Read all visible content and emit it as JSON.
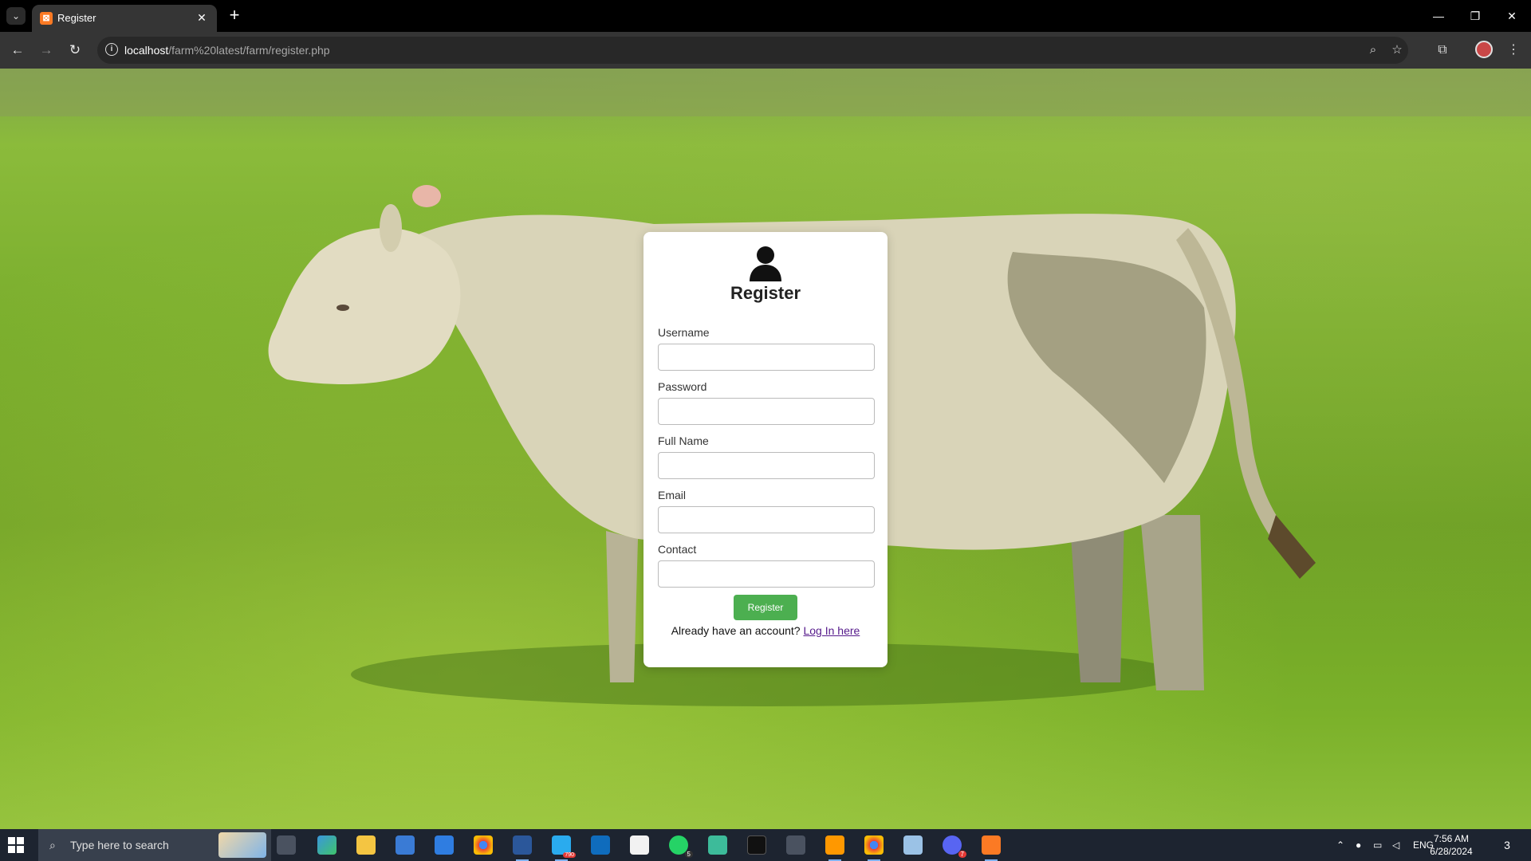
{
  "browser": {
    "tab_title": "Register",
    "tab_favicon_icon": "xampp-icon",
    "url_host": "localhost",
    "url_path": "/farm%20latest/farm/register.php"
  },
  "page": {
    "title": "Register",
    "fields": [
      {
        "label": "Username",
        "value": ""
      },
      {
        "label": "Password",
        "value": ""
      },
      {
        "label": "Full Name",
        "value": ""
      },
      {
        "label": "Email",
        "value": ""
      },
      {
        "label": "Contact",
        "value": ""
      }
    ],
    "submit_label": "Register",
    "login_prompt": "Already have an account?",
    "login_link": "Log In here",
    "accent_color": "#4caf50"
  },
  "taskbar": {
    "search_placeholder": "Type here to search",
    "language": "ENG",
    "time": "7:56 AM",
    "date": "6/28/2024",
    "notification_count": "3",
    "badges": {
      "telegram": "790",
      "whatsapp": "5",
      "discord": "7"
    }
  }
}
